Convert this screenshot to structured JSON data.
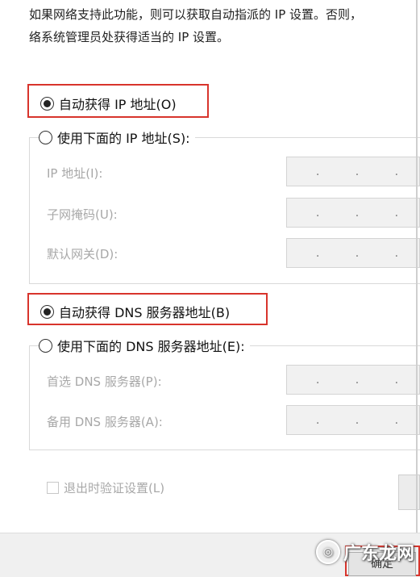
{
  "description": {
    "line1": "如果网络支持此功能，则可以获取自动指派的 IP 设置。否则，",
    "line2": "络系统管理员处获得适当的 IP 设置。"
  },
  "ip_section": {
    "auto_label": "自动获得 IP 地址(O)",
    "auto_selected": true,
    "manual_label": "使用下面的 IP 地址(S):",
    "manual_selected": false,
    "fields": [
      {
        "label": "IP 地址(I):",
        "value": ". . ."
      },
      {
        "label": "子网掩码(U):",
        "value": ". . ."
      },
      {
        "label": "默认网关(D):",
        "value": ". . ."
      }
    ]
  },
  "dns_section": {
    "auto_label": "自动获得 DNS 服务器地址(B)",
    "auto_selected": true,
    "manual_label": "使用下面的 DNS 服务器地址(E):",
    "manual_selected": false,
    "fields": [
      {
        "label": "首选 DNS 服务器(P):",
        "value": ". . ."
      },
      {
        "label": "备用 DNS 服务器(A):",
        "value": ". . ."
      }
    ]
  },
  "validate_checkbox": {
    "label": "退出时验证设置(L)",
    "checked": false
  },
  "ok_button": {
    "label": "确定"
  },
  "watermark": {
    "text": "广东龙网",
    "icon": "circle-logo-icon"
  },
  "colors": {
    "highlight": "#d8342c",
    "disabled_text": "#a8a8a8"
  }
}
